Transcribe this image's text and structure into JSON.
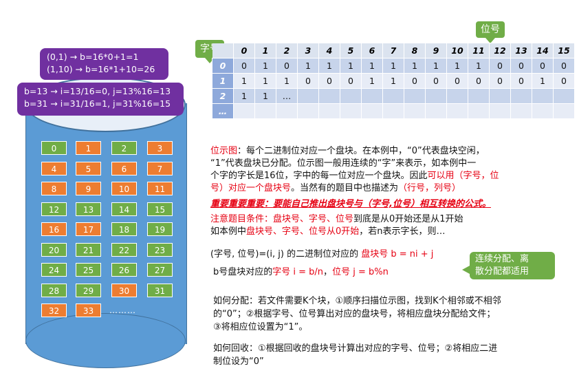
{
  "disk": {
    "blocks": [
      {
        "n": "0",
        "s": "free"
      },
      {
        "n": "1",
        "s": "used"
      },
      {
        "n": "2",
        "s": "free"
      },
      {
        "n": "3",
        "s": "used"
      },
      {
        "n": "4",
        "s": "used"
      },
      {
        "n": "5",
        "s": "used"
      },
      {
        "n": "6",
        "s": "used"
      },
      {
        "n": "7",
        "s": "used"
      },
      {
        "n": "8",
        "s": "used"
      },
      {
        "n": "9",
        "s": "used"
      },
      {
        "n": "10",
        "s": "used"
      },
      {
        "n": "11",
        "s": "used"
      },
      {
        "n": "12",
        "s": "free"
      },
      {
        "n": "13",
        "s": "free"
      },
      {
        "n": "14",
        "s": "free"
      },
      {
        "n": "15",
        "s": "free"
      },
      {
        "n": "16",
        "s": "used"
      },
      {
        "n": "17",
        "s": "used"
      },
      {
        "n": "18",
        "s": "free"
      },
      {
        "n": "19",
        "s": "free"
      },
      {
        "n": "20",
        "s": "free"
      },
      {
        "n": "21",
        "s": "free"
      },
      {
        "n": "22",
        "s": "free"
      },
      {
        "n": "23",
        "s": "free"
      },
      {
        "n": "24",
        "s": "free"
      },
      {
        "n": "25",
        "s": "free"
      },
      {
        "n": "26",
        "s": "free"
      },
      {
        "n": "27",
        "s": "free"
      },
      {
        "n": "28",
        "s": "free"
      },
      {
        "n": "29",
        "s": "free"
      },
      {
        "n": "30",
        "s": "used"
      },
      {
        "n": "31",
        "s": "free"
      },
      {
        "n": "32",
        "s": "used"
      },
      {
        "n": "33",
        "s": "used"
      }
    ],
    "ellipsis": "………",
    "colors": {
      "free": "#70ad47",
      "used": "#ed7d31",
      "disk": "#5b9bd5"
    }
  },
  "callouts": {
    "formula1": "(0,1) → b=16*0+1=1\n(1,10) → b=16*1+10=26",
    "formula2": "b=13 → i=13/16=0, j=13%16=13\nb=31 → i=31/16=1, j=31%16=15"
  },
  "bitmap": {
    "col_tag": "位号",
    "row_tag": "字号",
    "columns": [
      "0",
      "1",
      "2",
      "3",
      "4",
      "5",
      "6",
      "7",
      "8",
      "9",
      "10",
      "11",
      "12",
      "13",
      "14",
      "15"
    ],
    "rows": [
      {
        "label": "0",
        "cells": [
          "0",
          "1",
          "0",
          "1",
          "1",
          "1",
          "1",
          "1",
          "1",
          "1",
          "1",
          "1",
          "0",
          "0",
          "0",
          "0"
        ]
      },
      {
        "label": "1",
        "cells": [
          "1",
          "1",
          "1",
          "0",
          "0",
          "0",
          "1",
          "1",
          "0",
          "0",
          "0",
          "0",
          "0",
          "0",
          "1",
          "0"
        ]
      },
      {
        "label": "2",
        "cells": [
          "1",
          "1",
          "…",
          "",
          "",
          "",
          "",
          "",
          "",
          "",
          "",
          "",
          "",
          "",
          "",
          ""
        ]
      },
      {
        "label": "…",
        "cells": [
          "",
          "",
          "",
          "",
          "",
          "",
          "",
          "",
          "",
          "",
          "",
          "",
          "",
          "",
          "",
          ""
        ]
      }
    ]
  },
  "text": {
    "p1_l1a": "位示图",
    "p1_l1b": "：每个二进制位对应一个盘块。在本例中，“0”代表盘块空闲，",
    "p1_l2": "“1”代表盘块已分配。位示图一般用连续的“字”来表示，如本例中一",
    "p1_l3a": "个字的字长是16位，字中的每一位对应一个盘块。因此",
    "p1_l3b": "可以用（字号，位",
    "p1_l4a": "号）对应一个盘块号",
    "p1_l4b": "。当然有的题目中也描述为",
    "p1_l4c": "（行号，列号）",
    "important": "重要重要重要：要能自己推出盘块号与（字号,位号）相互转换的公式。",
    "cond_l1a": "注意题目条件：盘块号、字号、位号",
    "cond_l1b": "到底是从0开始还是从1开始",
    "cond_l2a": "如本例中",
    "cond_l2b": "盘块号、字号、位号从0开始",
    "cond_l2c": "，若n表示字长，则…",
    "f1a": "(字号, 位号)=(i, j) 的二进制位对应的 ",
    "f1b": "盘块号 b = ni + j",
    "f2a": "b号盘块对应的",
    "f2b": "字号 i = b/n",
    "f2c": "，",
    "f2d": "位号 j = b%n",
    "note": "连续分配、离\n散分配都适用",
    "alloc": "如何分配：若文件需要K个块，①顺序扫描位示图，找到K个相邻或不相邻\n的“0”；②根据字号、位号算出对应的盘块号，将相应盘块分配给文件；\n③将相应位设置为“1”。",
    "recycle": "如何回收：①根据回收的盘块号计算出对应的字号、位号；②将相应二进\n制位设为“0”"
  }
}
